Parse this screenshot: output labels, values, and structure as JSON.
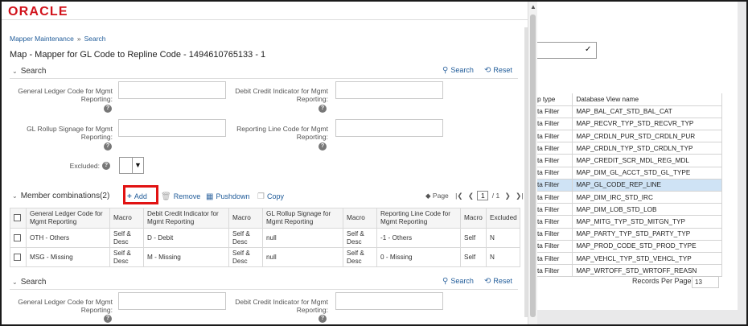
{
  "background": {
    "table_header": [
      "p type",
      "Database View name"
    ],
    "rows": [
      [
        "ta Filter",
        "MAP_BAL_CAT_STD_BAL_CAT"
      ],
      [
        "ta Filter",
        "MAP_RECVR_TYP_STD_RECVR_TYP"
      ],
      [
        "ta Filter",
        "MAP_CRDLN_PUR_STD_CRDLN_PUR"
      ],
      [
        "ta Filter",
        "MAP_CRDLN_TYP_STD_CRDLN_TYP"
      ],
      [
        "ta Filter",
        "MAP_CREDIT_SCR_MDL_REG_MDL"
      ],
      [
        "ta Filter",
        "MAP_DIM_GL_ACCT_STD_GL_TYPE"
      ],
      [
        "ta Filter",
        "MAP_GL_CODE_REP_LINE"
      ],
      [
        "ta Filter",
        "MAP_DIM_IRC_STD_IRC"
      ],
      [
        "ta Filter",
        "MAP_DIM_LOB_STD_LOB"
      ],
      [
        "ta Filter",
        "MAP_MITG_TYP_STD_MITGN_TYP"
      ],
      [
        "ta Filter",
        "MAP_PARTY_TYP_STD_PARTY_TYP"
      ],
      [
        "ta Filter",
        "MAP_PROD_CODE_STD_PROD_TYPE"
      ],
      [
        "ta Filter",
        "MAP_VEHCL_TYP_STD_VEHCL_TYP"
      ],
      [
        "ta Filter",
        "MAP_WRTOFF_STD_WRTOFF_REASN"
      ]
    ],
    "selected_row": 6,
    "records_per_page_label": "Records Per Page",
    "records_per_page_value": "13"
  },
  "modal": {
    "logo_text": "ORACLE",
    "breadcrumb": [
      "Mapper Maintenance",
      "Search"
    ],
    "breadcrumb_sep": "»",
    "title": "Map - Mapper for GL Code to Repline Code - 1494610765133 - 1",
    "search": {
      "heading": "Search",
      "search_label": "Search",
      "reset_label": "Reset",
      "fields": {
        "gl_code": "General Ledger Code for Mgmt Reporting:",
        "debit_credit": "Debit Credit Indicator for Mgmt Reporting:",
        "gl_rollup": "GL Rollup Signage for Mgmt Reporting:",
        "reporting_line": "Reporting Line Code for Mgmt Reporting:",
        "excluded": "Excluded:"
      },
      "help_glyph": "?"
    },
    "members": {
      "heading": "Member combinations(2)",
      "add_label": "Add",
      "remove_label": "Remove",
      "pushdown_label": "Pushdown",
      "copy_label": "Copy",
      "pager_label": "Page",
      "current_page": "1",
      "total_pages": "/ 1",
      "columns": [
        "General Ledger Code for Mgmt Reporting",
        "Macro",
        "Debit Credit Indicator for Mgmt Reporting",
        "Macro",
        "GL Rollup Signage for Mgmt Reporting",
        "Macro",
        "Reporting Line Code for Mgmt Reporting",
        "Macro",
        "Excluded"
      ],
      "rows": [
        [
          "OTH - Others",
          "Self & Desc",
          "D - Debit",
          "Self & Desc",
          "null",
          "Self & Desc",
          "-1 - Others",
          "Self",
          "N"
        ],
        [
          "MSG - Missing",
          "Self & Desc",
          "M - Missing",
          "Self & Desc",
          "null",
          "Self & Desc",
          "0 - Missing",
          "Self",
          "N"
        ]
      ]
    },
    "search2": {
      "heading": "Search",
      "search_label": "Search",
      "reset_label": "Reset",
      "gl_code": "General Ledger Code for Mgmt Reporting:",
      "debit_credit": "Debit Credit Indicator for Mgmt Reporting:"
    }
  },
  "colors": {
    "link": "#1f5b99",
    "highlight_row": "#cfe3f5",
    "add_outline": "#e11212",
    "logo": "#d1121b"
  }
}
